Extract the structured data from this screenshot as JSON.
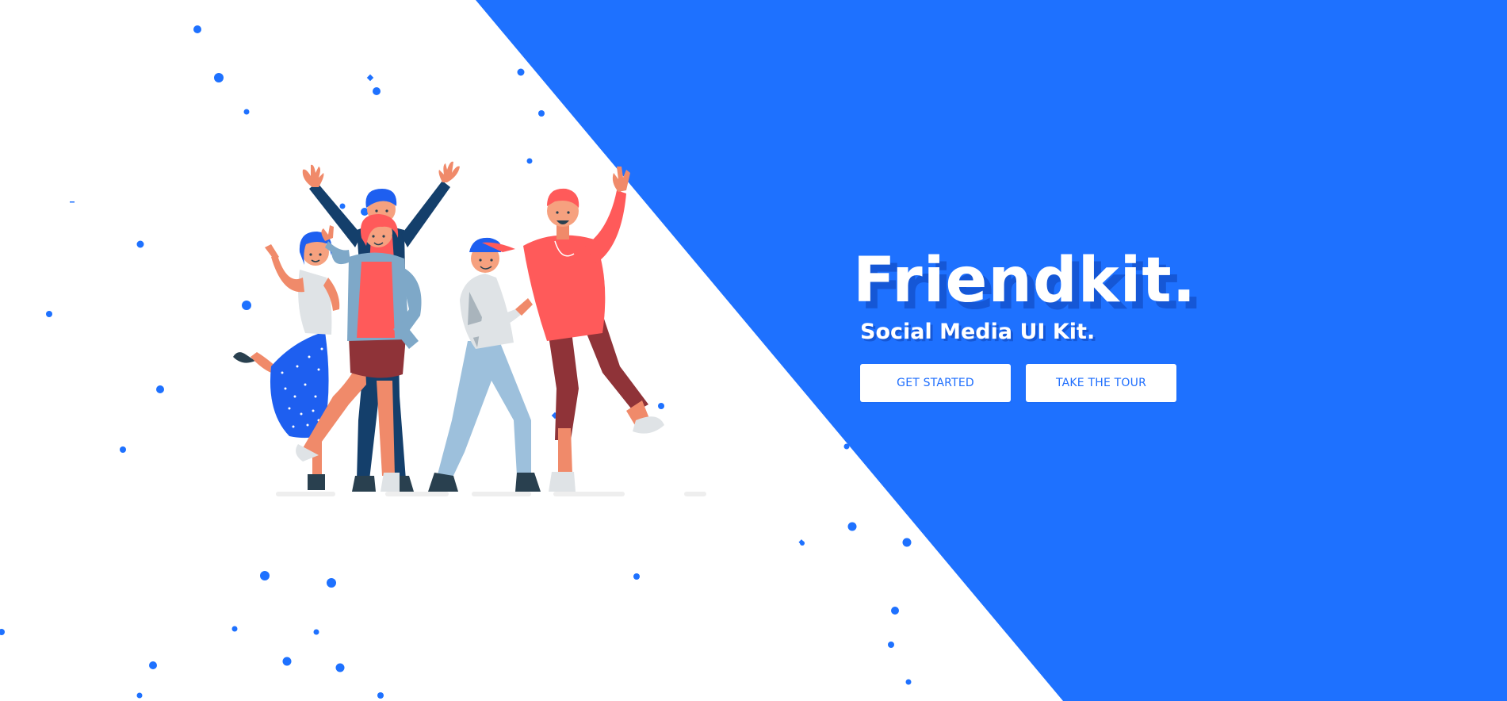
{
  "colors": {
    "primary_blue": "#1e71ff",
    "dark_blue_shadow": "#1557d6",
    "white": "#ffffff"
  },
  "hero": {
    "title": "Friendkit.",
    "subtitle": "Social Media UI Kit.",
    "illustration_icon": "group-of-friends-illustration"
  },
  "actions": {
    "get_started_label": "GET STARTED",
    "take_tour_label": "TAKE THE TOUR"
  }
}
